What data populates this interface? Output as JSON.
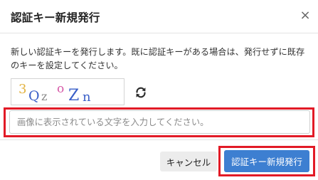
{
  "dialog": {
    "title": "認証キー新規発行",
    "close_label": "×",
    "description": "新しい認証キーを発行します。既に認証キーがある場合は、発行せずに既存のキーを設定してください。"
  },
  "captcha": {
    "characters": [
      "3",
      "Q",
      "z",
      "o",
      "Z",
      "n"
    ],
    "colors": [
      "#e3b341",
      "#3a5fc8",
      "#8a8a8a",
      "#d65aa8",
      "#3a5fc8",
      "#3a5fc8"
    ],
    "refresh_icon": "refresh-icon"
  },
  "input": {
    "placeholder": "画像に表示されている文字を入力してください。",
    "value": ""
  },
  "buttons": {
    "cancel_label": "キャンセル",
    "submit_label": "認証キー新規発行"
  },
  "colors": {
    "highlight": "#e21a26",
    "primary": "#3d7fd1"
  }
}
